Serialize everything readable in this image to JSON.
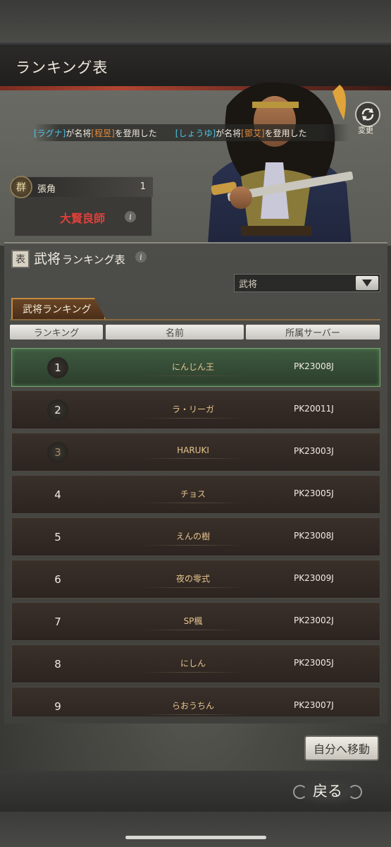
{
  "header": {
    "title": "ランキング表"
  },
  "ticker": [
    {
      "player": "[ラグナ]",
      "mid": "が名将",
      "general": "[程昱]",
      "tail": "を登用した"
    },
    {
      "player": "[しょうゆ]",
      "mid": "が名将",
      "general": "[鄧艾]",
      "tail": "を登用した"
    }
  ],
  "refresh": {
    "label": "変更",
    "icon": "refresh-icon"
  },
  "faction_card": {
    "badge": "群",
    "name": "張角",
    "count": "1",
    "title": "大賢良師",
    "info": "i"
  },
  "panel": {
    "icon_char": "表",
    "title_main": "武将",
    "title_sub": "ランキング表",
    "info": "i"
  },
  "dropdown": {
    "selected": "武将"
  },
  "tab": {
    "label": "武将ランキング"
  },
  "columns": [
    "ランキング",
    "名前",
    "所属サーバー"
  ],
  "rows": [
    {
      "rank": "1",
      "name": "にんじん王",
      "server": "PK23008J"
    },
    {
      "rank": "2",
      "name": "ラ・リーガ",
      "server": "PK20011J"
    },
    {
      "rank": "3",
      "name": "HARUKI",
      "server": "PK23003J"
    },
    {
      "rank": "4",
      "name": "チョス",
      "server": "PK23005J"
    },
    {
      "rank": "5",
      "name": "えんの樹",
      "server": "PK23008J"
    },
    {
      "rank": "6",
      "name": "夜の零式",
      "server": "PK23009J"
    },
    {
      "rank": "7",
      "name": "SP楓",
      "server": "PK23002J"
    },
    {
      "rank": "8",
      "name": "にしん",
      "server": "PK23005J"
    },
    {
      "rank": "9",
      "name": "らおうちん",
      "server": "PK23007J"
    }
  ],
  "buttons": {
    "goto_self": "自分へ移動",
    "back": "戻る"
  },
  "colors": {
    "first_row_highlight": "#3e5a40",
    "name_color": "#e7c58e",
    "accent_red": "#e0403a"
  }
}
